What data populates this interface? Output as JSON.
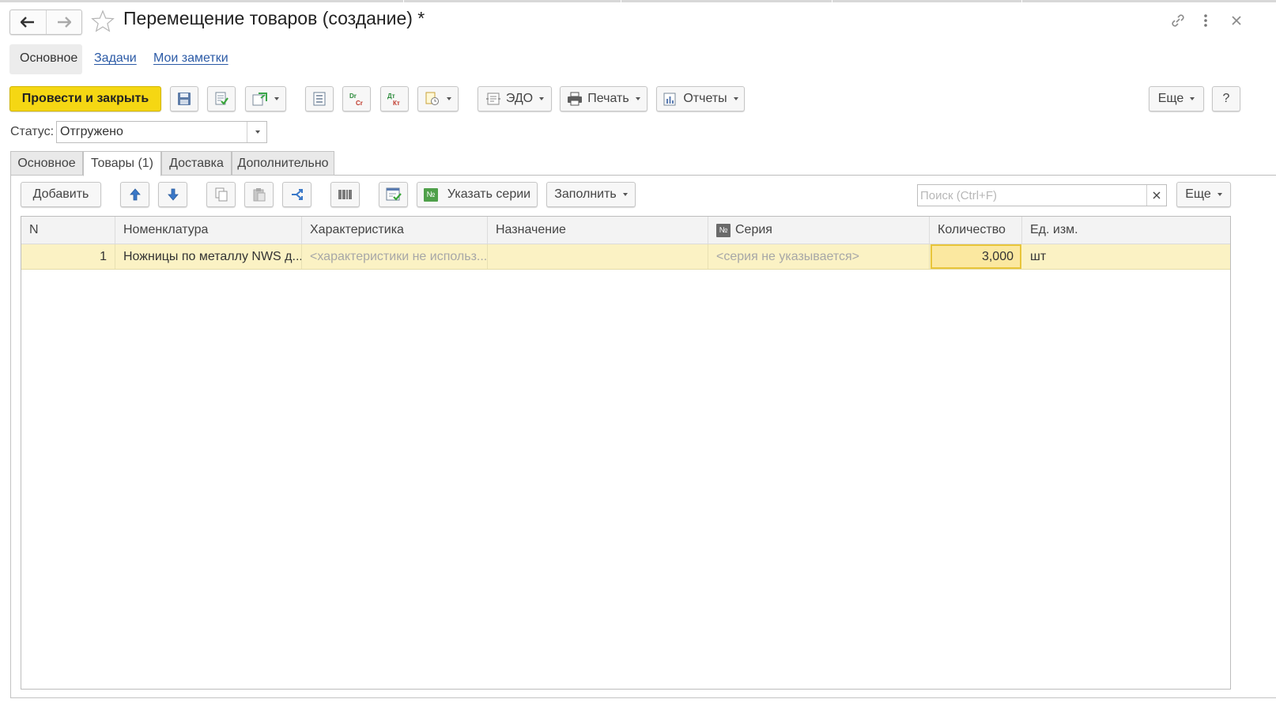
{
  "window": {
    "title": "Перемещение товаров (создание) *"
  },
  "sections": {
    "main": "Основное",
    "tasks": "Задачи",
    "notes": "Мои заметки"
  },
  "toolbar": {
    "post_close": "Провести и закрыть",
    "edo": "ЭДО",
    "print": "Печать",
    "reports": "Отчеты",
    "more": "Еще",
    "help": "?"
  },
  "status": {
    "label": "Статус:",
    "value": "Отгружено"
  },
  "tabs": [
    {
      "label": "Основное",
      "active": false
    },
    {
      "label": "Товары (1)",
      "active": true
    },
    {
      "label": "Доставка",
      "active": false
    },
    {
      "label": "Дополнительно",
      "active": false
    }
  ],
  "goods_toolbar": {
    "add": "Добавить",
    "series": "Указать серии",
    "series_icon": "№",
    "fill": "Заполнить",
    "search_placeholder": "Поиск (Ctrl+F)",
    "more": "Еще"
  },
  "table": {
    "columns": [
      "N",
      "Номенклатура",
      "Характеристика",
      "Назначение",
      "Серия",
      "Количество",
      "Ед. изм."
    ],
    "series_col_icon": "№",
    "rows": [
      {
        "n": "1",
        "item": "Ножницы по металлу NWS д...",
        "characteristic": "<характеристики не использ...",
        "purpose": "",
        "series": "<серия не указывается>",
        "quantity": "3,000",
        "unit": "шт"
      }
    ]
  },
  "colors": {
    "accent_button": "#f5d713",
    "selected_row": "#fbf2c4",
    "link": "#2b5aa6"
  }
}
